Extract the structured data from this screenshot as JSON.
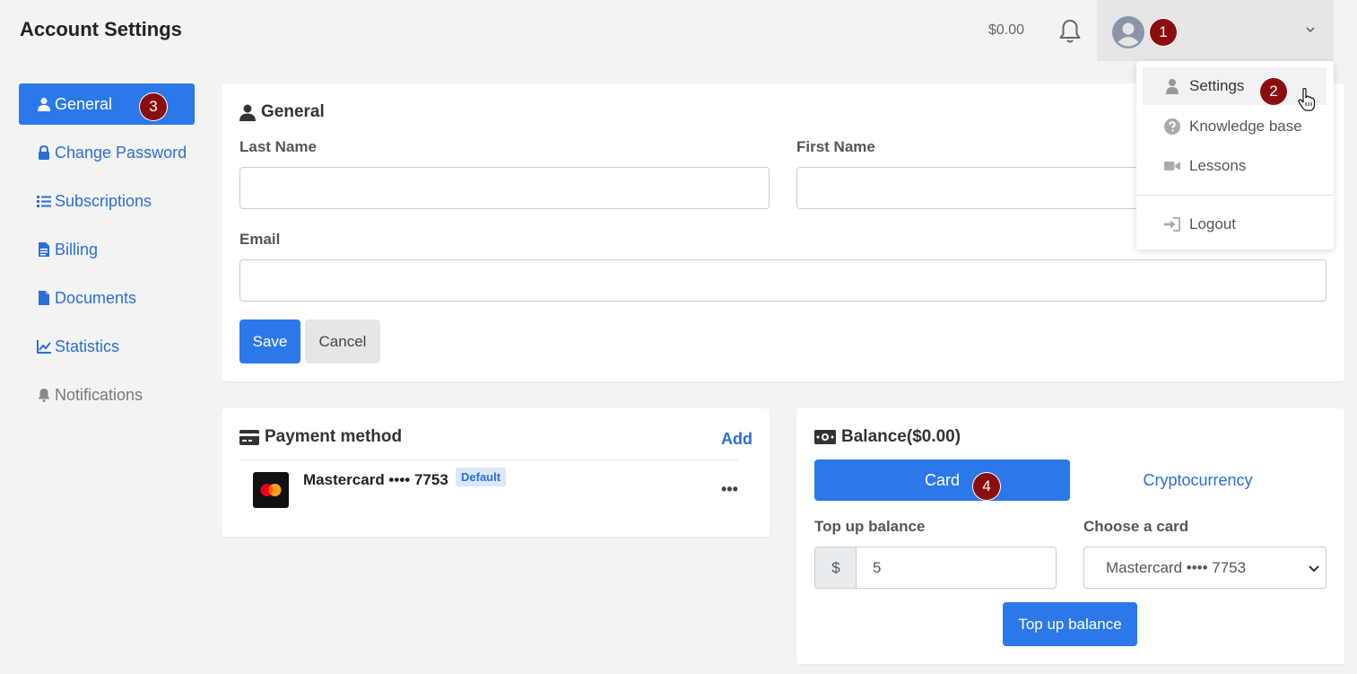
{
  "header": {
    "title": "Account Settings",
    "balance": "$0.00"
  },
  "badges": [
    "1",
    "2",
    "3",
    "4"
  ],
  "sidebar": {
    "items": [
      {
        "label": "General",
        "icon": "user-icon",
        "state": "active"
      },
      {
        "label": "Change Password",
        "icon": "lock-icon",
        "state": "normal"
      },
      {
        "label": "Subscriptions",
        "icon": "list-icon",
        "state": "normal"
      },
      {
        "label": "Billing",
        "icon": "invoice-icon",
        "state": "normal"
      },
      {
        "label": "Documents",
        "icon": "file-icon",
        "state": "normal"
      },
      {
        "label": "Statistics",
        "icon": "chart-line-icon",
        "state": "normal"
      },
      {
        "label": "Notifications",
        "icon": "bell-icon",
        "state": "disabled"
      }
    ]
  },
  "general": {
    "title": "General",
    "last_name_label": "Last Name",
    "last_name_value": "",
    "first_name_label": "First Name",
    "first_name_value": "",
    "email_label": "Email",
    "email_value": "",
    "save_label": "Save",
    "cancel_label": "Cancel"
  },
  "payment": {
    "title": "Payment method",
    "add_label": "Add",
    "card_name": "Mastercard •••• 7753",
    "default_label": "Default",
    "more_label": "•••"
  },
  "balance": {
    "title": "Balance($0.00)",
    "tab_card": "Card",
    "tab_crypto": "Cryptocurrency",
    "topup_label": "Top up balance",
    "currency_prefix": "$",
    "amount_value": "5",
    "choose_card_label": "Choose a card",
    "selected_card": "Mastercard •••• 7753",
    "topup_button": "Top up balance"
  },
  "user_menu": {
    "items": [
      {
        "label": "Settings",
        "icon": "user-icon"
      },
      {
        "label": "Knowledge base",
        "icon": "question-circle-icon"
      },
      {
        "label": "Lessons",
        "icon": "video-icon"
      },
      {
        "label": "Logout",
        "icon": "sign-in-icon"
      }
    ]
  },
  "colors": {
    "primary": "#2b78e8",
    "link": "#2a6fd6",
    "badge": "#8b0e0e",
    "background": "#f3f3f3"
  }
}
